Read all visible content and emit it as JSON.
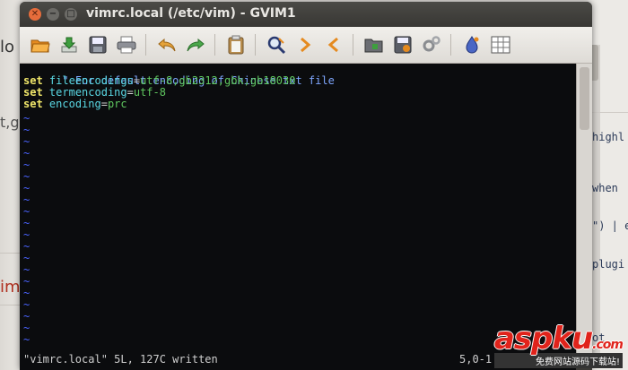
{
  "window": {
    "title": "vimrc.local (/etc/vim) - GVIM1",
    "controls": {
      "close": "✕",
      "minimize": "−",
      "maximize": "□"
    }
  },
  "toolbar": {
    "icons": [
      "open-folder-icon",
      "save-download-icon",
      "save-icon",
      "print-icon",
      "undo-icon",
      "redo-icon",
      "paste-icon",
      "find-replace-icon",
      "next-icon",
      "previous-icon",
      "load-session-icon",
      "save-session-icon",
      "run-script-icon",
      "make-icon",
      "tags-icon"
    ]
  },
  "editor": {
    "lines": [
      {
        "type": "comment",
        "text": "\" For default encoding of Chinese txt file"
      },
      {
        "type": "set",
        "kw": "set",
        "opt": "fileencodings",
        "eq": "=",
        "val": "utf-8,gb2312,gbk,gb18030"
      },
      {
        "type": "set",
        "kw": "set",
        "opt": "termencoding",
        "eq": "=",
        "val": "utf-8"
      },
      {
        "type": "set",
        "kw": "set",
        "opt": "encoding",
        "eq": "=",
        "val": "prc"
      }
    ],
    "tilde": "~",
    "colors": {
      "background": "#0b0c0e",
      "comment": "#7fa7ff",
      "keyword": "#f0e66a",
      "option": "#5ad8e4",
      "value": "#5fc75f",
      "tilde": "#4a63ff"
    }
  },
  "status": {
    "message": "\"vimrc.local\" 5L, 127C written",
    "position": "5,0-1"
  },
  "background": {
    "left_fragments": {
      "lo": "lo",
      "gb": "t,gb",
      "im": "im"
    },
    "right_fragments": {
      "highl": "highl",
      "when": "when",
      "e": "\") | e",
      "plugi": "plugi",
      "ot": "ot"
    }
  },
  "watermark": {
    "logo": "aspku",
    "domain": ".com",
    "tagline": "免费网站源码下载站!"
  }
}
